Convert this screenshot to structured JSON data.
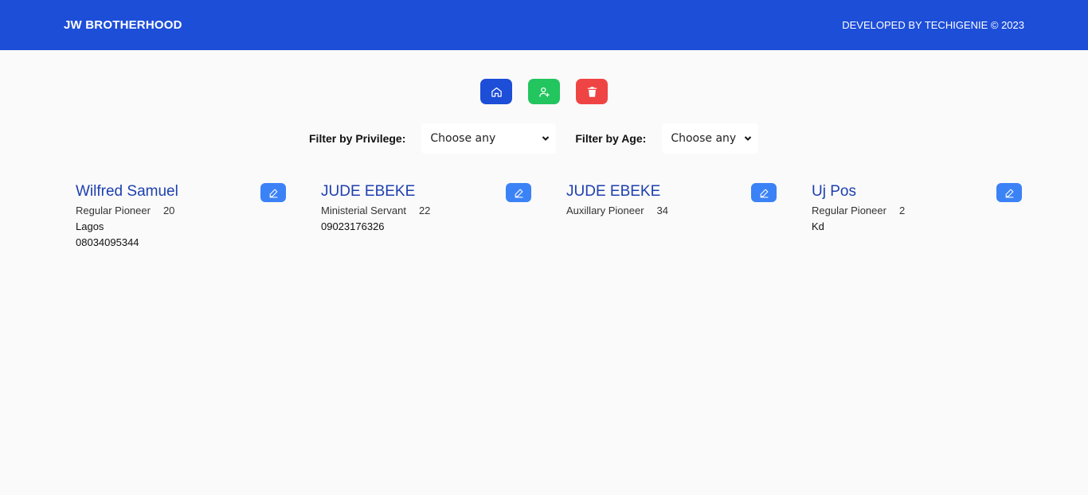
{
  "header": {
    "brand": "JW BROTHERHOOD",
    "credit": "DEVELOPED BY TECHIGENIE © 2023"
  },
  "actions": {
    "home_icon": "home-icon",
    "add_icon": "user-plus-icon",
    "delete_icon": "trash-icon"
  },
  "filters": {
    "privilege_label": "Filter by Privilege:",
    "privilege_value": "Choose any",
    "age_label": "Filter by Age:",
    "age_value": "Choose any"
  },
  "members": [
    {
      "name": "Wilfred Samuel",
      "privilege": "Regular Pioneer",
      "age": "20",
      "location": "Lagos",
      "phone": "08034095344"
    },
    {
      "name": "JUDE EBEKE",
      "privilege": "Ministerial Servant",
      "age": "22",
      "location": "",
      "phone": "09023176326"
    },
    {
      "name": "JUDE EBEKE",
      "privilege": "Auxillary Pioneer",
      "age": "34",
      "location": "",
      "phone": ""
    },
    {
      "name": "Uj Pos",
      "privilege": "Regular Pioneer",
      "age": "2",
      "location": "Kd",
      "phone": ""
    }
  ],
  "colors": {
    "primary": "#1d4ed8",
    "success": "#22c55e",
    "danger": "#ef4444",
    "edit": "#3b82f6"
  }
}
